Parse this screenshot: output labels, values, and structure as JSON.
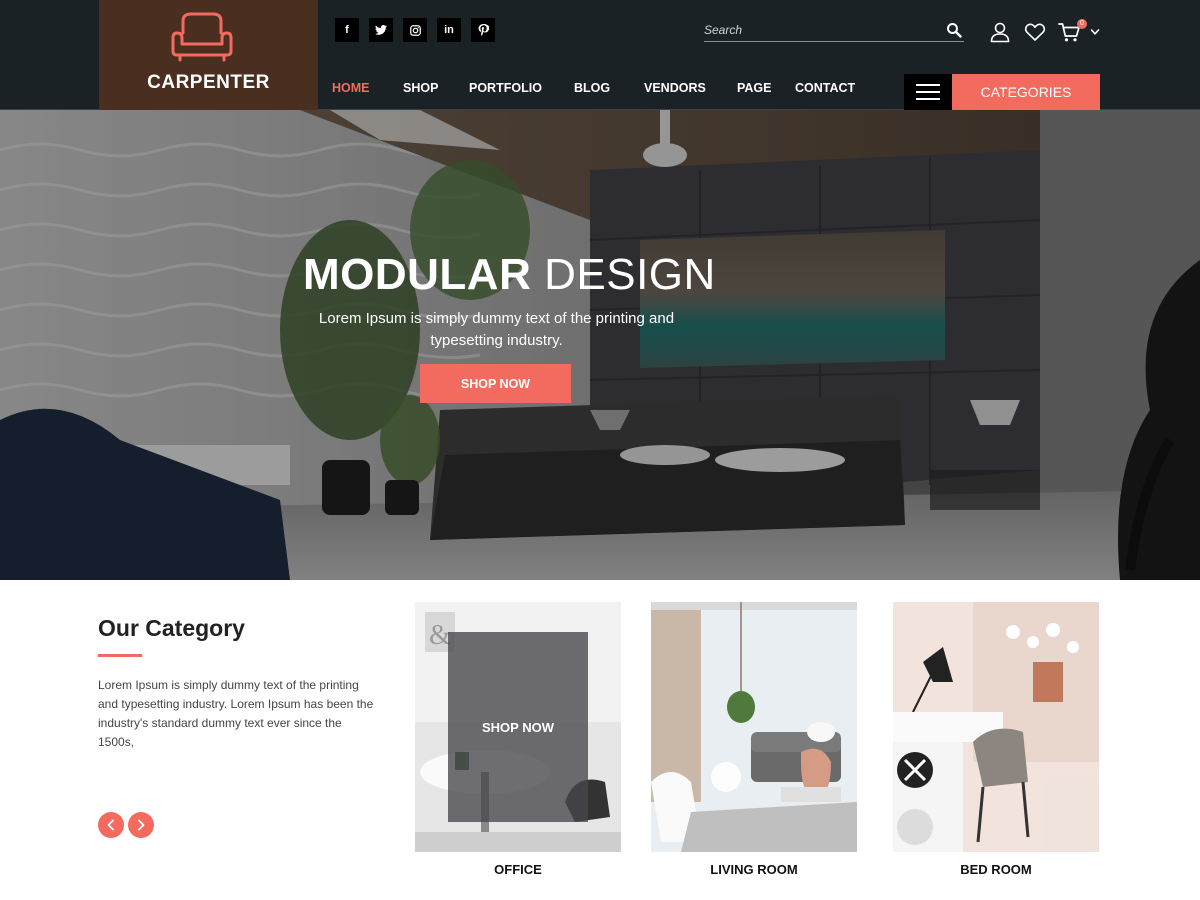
{
  "brand": {
    "name": "CARPENTER",
    "icon": "armchair-icon",
    "logo_bg": "#4a2e1f",
    "accent": "#f36b5e"
  },
  "social": [
    {
      "icon": "facebook-icon",
      "glyph": "f"
    },
    {
      "icon": "twitter-icon",
      "glyph": "t"
    },
    {
      "icon": "instagram-icon",
      "glyph": "◘"
    },
    {
      "icon": "linkedin-icon",
      "glyph": "in"
    },
    {
      "icon": "pinterest-icon",
      "glyph": "P"
    }
  ],
  "search": {
    "placeholder": "Search"
  },
  "header_icons": [
    "user-icon",
    "heart-icon",
    "cart-icon",
    "chevron-down-icon"
  ],
  "cart_count": "0",
  "nav": {
    "items": [
      "HOME",
      "SHOP",
      "PORTFOLIO",
      "BLOG",
      "VENDORS",
      "PAGE",
      "CONTACT"
    ],
    "active": "HOME",
    "categories_label": "CATEGORIES"
  },
  "hero": {
    "title_bold": "MODULAR",
    "title_light": "DESIGN",
    "subtitle": "Lorem Ipsum is simply dummy text of the printing and typesetting industry.",
    "button": "SHOP NOW"
  },
  "category_section": {
    "title": "Our Category",
    "text": "Lorem Ipsum is simply dummy text of the printing and typesetting industry. Lorem Ipsum has been the industry's standard dummy text ever since the 1500s,",
    "prev_icon": "chevron-left-icon",
    "next_icon": "chevron-right-icon",
    "cards": [
      {
        "label": "OFFICE",
        "overlay": "SHOP NOW"
      },
      {
        "label": "LIVING ROOM"
      },
      {
        "label": "BED ROOM"
      }
    ]
  }
}
